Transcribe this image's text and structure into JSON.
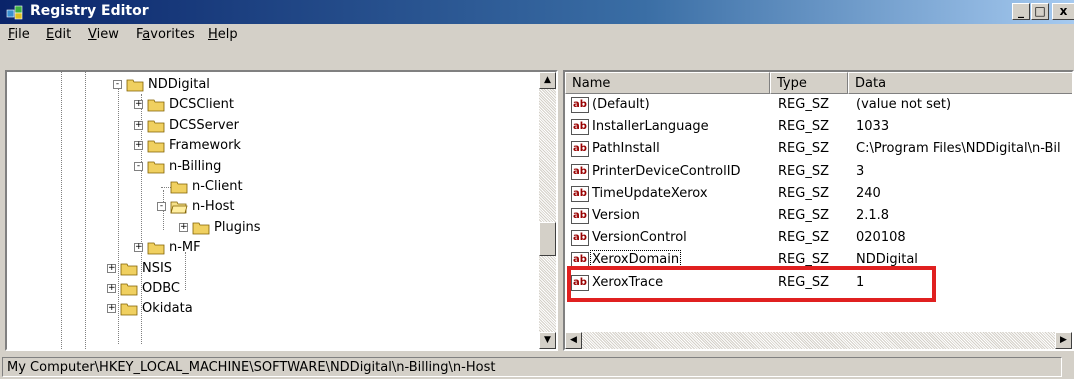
{
  "window": {
    "title": "Registry Editor"
  },
  "menu": [
    {
      "accel": "F",
      "rest": "ile"
    },
    {
      "accel": "E",
      "rest": "dit"
    },
    {
      "accel": "V",
      "rest": "iew"
    },
    {
      "pre": "F",
      "accel": "a",
      "rest": "vorites"
    },
    {
      "accel": "H",
      "rest": "elp"
    }
  ],
  "tree": [
    {
      "label": "NDDigital",
      "level": 0,
      "expander": "-",
      "open": false
    },
    {
      "label": "DCSClient",
      "level": 1,
      "expander": "+"
    },
    {
      "label": "DCSServer",
      "level": 1,
      "expander": "+"
    },
    {
      "label": "Framework",
      "level": 1,
      "expander": "+"
    },
    {
      "label": "n-Billing",
      "level": 1,
      "expander": "-"
    },
    {
      "label": "n-Client",
      "level": 2,
      "expander": ""
    },
    {
      "label": "n-Host",
      "level": 2,
      "expander": "-",
      "open": true
    },
    {
      "label": "Plugins",
      "level": 3,
      "expander": "+"
    },
    {
      "label": "n-MF",
      "level": 1,
      "expander": "+"
    },
    {
      "label": "NSIS",
      "level": -1,
      "expander": "+"
    },
    {
      "label": "ODBC",
      "level": -1,
      "expander": "+"
    },
    {
      "label": "Okidata",
      "level": -1,
      "expander": "+"
    }
  ],
  "list": {
    "columns": [
      "Name",
      "Type",
      "Data"
    ],
    "icon_label": "ab",
    "rows": [
      {
        "name": "(Default)",
        "type": "REG_SZ",
        "data": "(value not set)"
      },
      {
        "name": "InstallerLanguage",
        "type": "REG_SZ",
        "data": "1033"
      },
      {
        "name": "PathInstall",
        "type": "REG_SZ",
        "data": "C:\\Program Files\\NDDigital\\n-Bil"
      },
      {
        "name": "PrinterDeviceControlID",
        "type": "REG_SZ",
        "data": "3"
      },
      {
        "name": "TimeUpdateXerox",
        "type": "REG_SZ",
        "data": "240"
      },
      {
        "name": "Version",
        "type": "REG_SZ",
        "data": "2.1.8"
      },
      {
        "name": "VersionControl",
        "type": "REG_SZ",
        "data": "020108"
      },
      {
        "name": "XeroxDomain",
        "type": "REG_SZ",
        "data": "NDDigital"
      },
      {
        "name": "XeroxTrace",
        "type": "REG_SZ",
        "data": "1"
      }
    ]
  },
  "status": {
    "path": "My Computer\\HKEY_LOCAL_MACHINE\\SOFTWARE\\NDDigital\\n-Billing\\n-Host"
  },
  "colors": {
    "highlight_border": "#e02020",
    "title_bar": "#0a246a",
    "folder": "#f0d060"
  }
}
